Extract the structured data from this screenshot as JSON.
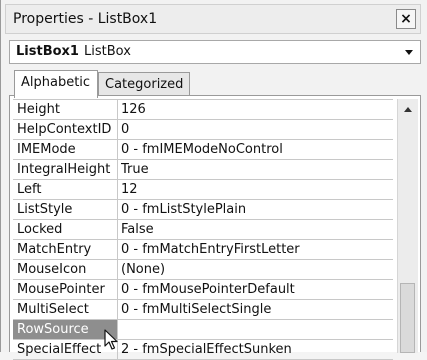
{
  "window": {
    "title": "Properties - ListBox1",
    "close_glyph": "×"
  },
  "object_selector": {
    "name": "ListBox1",
    "type": "ListBox"
  },
  "tabs": [
    {
      "label": "Alphabetic",
      "active": true
    },
    {
      "label": "Categorized",
      "active": false
    }
  ],
  "properties": [
    {
      "name": "Height",
      "value": "126"
    },
    {
      "name": "HelpContextID",
      "value": "0"
    },
    {
      "name": "IMEMode",
      "value": "0 - fmIMEModeNoControl"
    },
    {
      "name": "IntegralHeight",
      "value": "True"
    },
    {
      "name": "Left",
      "value": "12"
    },
    {
      "name": "ListStyle",
      "value": "0 - fmListStylePlain"
    },
    {
      "name": "Locked",
      "value": "False"
    },
    {
      "name": "MatchEntry",
      "value": "0 - fmMatchEntryFirstLetter"
    },
    {
      "name": "MouseIcon",
      "value": "(None)"
    },
    {
      "name": "MousePointer",
      "value": "0 - fmMousePointerDefault"
    },
    {
      "name": "MultiSelect",
      "value": "0 - fmMultiSelectSingle"
    },
    {
      "name": "RowSource",
      "value": "",
      "selected": true
    },
    {
      "name": "SpecialEffect",
      "value": "2 - fmSpecialEffectSunken"
    }
  ],
  "colors": {
    "selected_row": "#8e8e8e",
    "grid_line": "#c8c8c8"
  },
  "icons": {
    "close": "close-icon",
    "combo_dropdown": "chevron-down-icon",
    "scroll_up": "scroll-up-arrow-icon",
    "cursor": "mouse-pointer-icon"
  }
}
